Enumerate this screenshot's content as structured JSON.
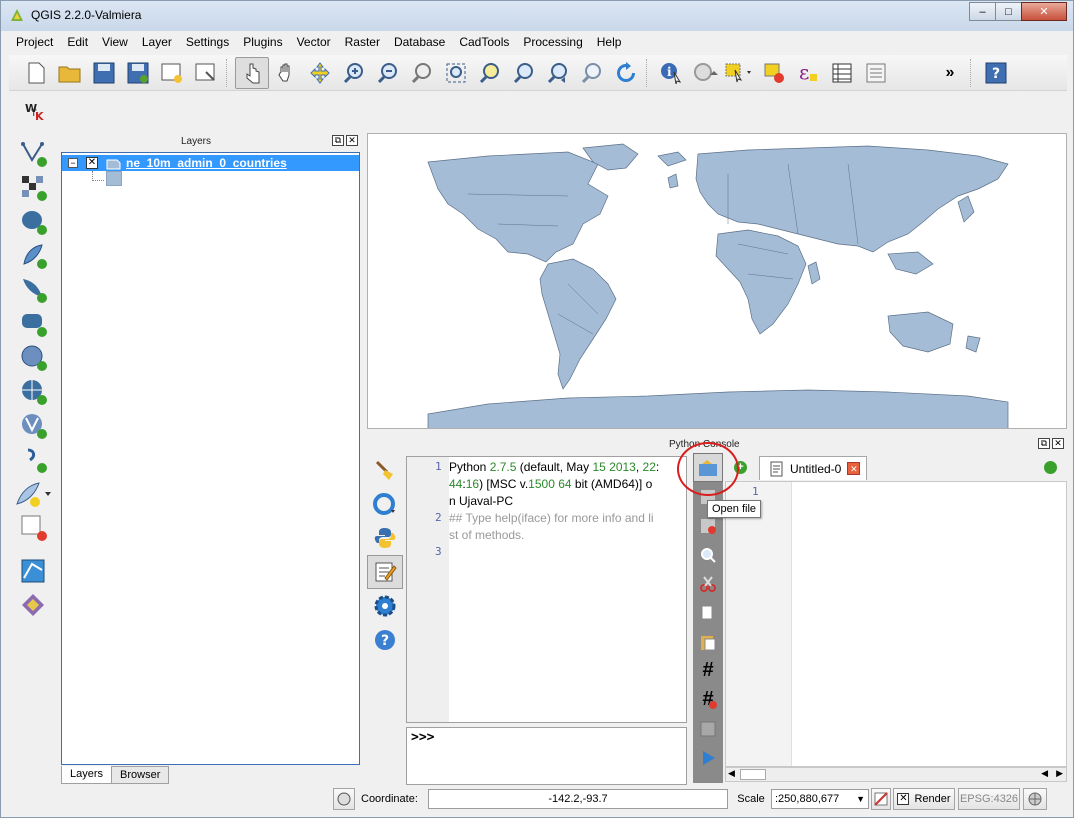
{
  "window": {
    "title": "QGIS 2.2.0-Valmiera",
    "minimize": "–",
    "maximize": "□",
    "close": "✕"
  },
  "menu": [
    "Project",
    "Edit",
    "View",
    "Layer",
    "Settings",
    "Plugins",
    "Vector",
    "Raster",
    "Database",
    "CadTools",
    "Processing",
    "Help"
  ],
  "toolbar": {
    "overflow": "»"
  },
  "layers_panel": {
    "title": "Layers",
    "layer_name": "ne_10m_admin_0_countries",
    "tabs": [
      "Layers",
      "Browser"
    ]
  },
  "console": {
    "title": "Python Console",
    "output_lines": [
      {
        "n": "1",
        "parts": [
          "Python ",
          "2.7.5",
          " (default, May ",
          "15",
          " ",
          "2013",
          ", ",
          "22",
          ":"
        ]
      },
      {
        "n": "",
        "parts": [
          "44",
          ":",
          "16",
          ") [MSC v.",
          "1500",
          " ",
          "64",
          " bit (AMD64)] o"
        ]
      },
      {
        "n": "",
        "parts": [
          "n Ujaval-PC"
        ]
      },
      {
        "n": "2",
        "parts": [
          "## Type help(iface) for more info and li"
        ]
      },
      {
        "n": "",
        "parts": [
          "st of methods."
        ]
      },
      {
        "n": "3",
        "parts": [
          ""
        ]
      }
    ],
    "prompt": ">>>",
    "tab_name": "Untitled-0",
    "editor_line": "1",
    "tooltip": "Open file"
  },
  "status": {
    "coordinate_label": "Coordinate:",
    "coordinate_value": "-142.2,-93.7",
    "scale_label": "Scale",
    "scale_value": ":250,880,677",
    "render_label": "Render",
    "epsg": "EPSG:4326"
  },
  "colors": {
    "map_fill": "#a5bcd6",
    "map_stroke": "#5c7088",
    "selection": "#3399ff",
    "highlight_circle": "#d81e1e"
  }
}
